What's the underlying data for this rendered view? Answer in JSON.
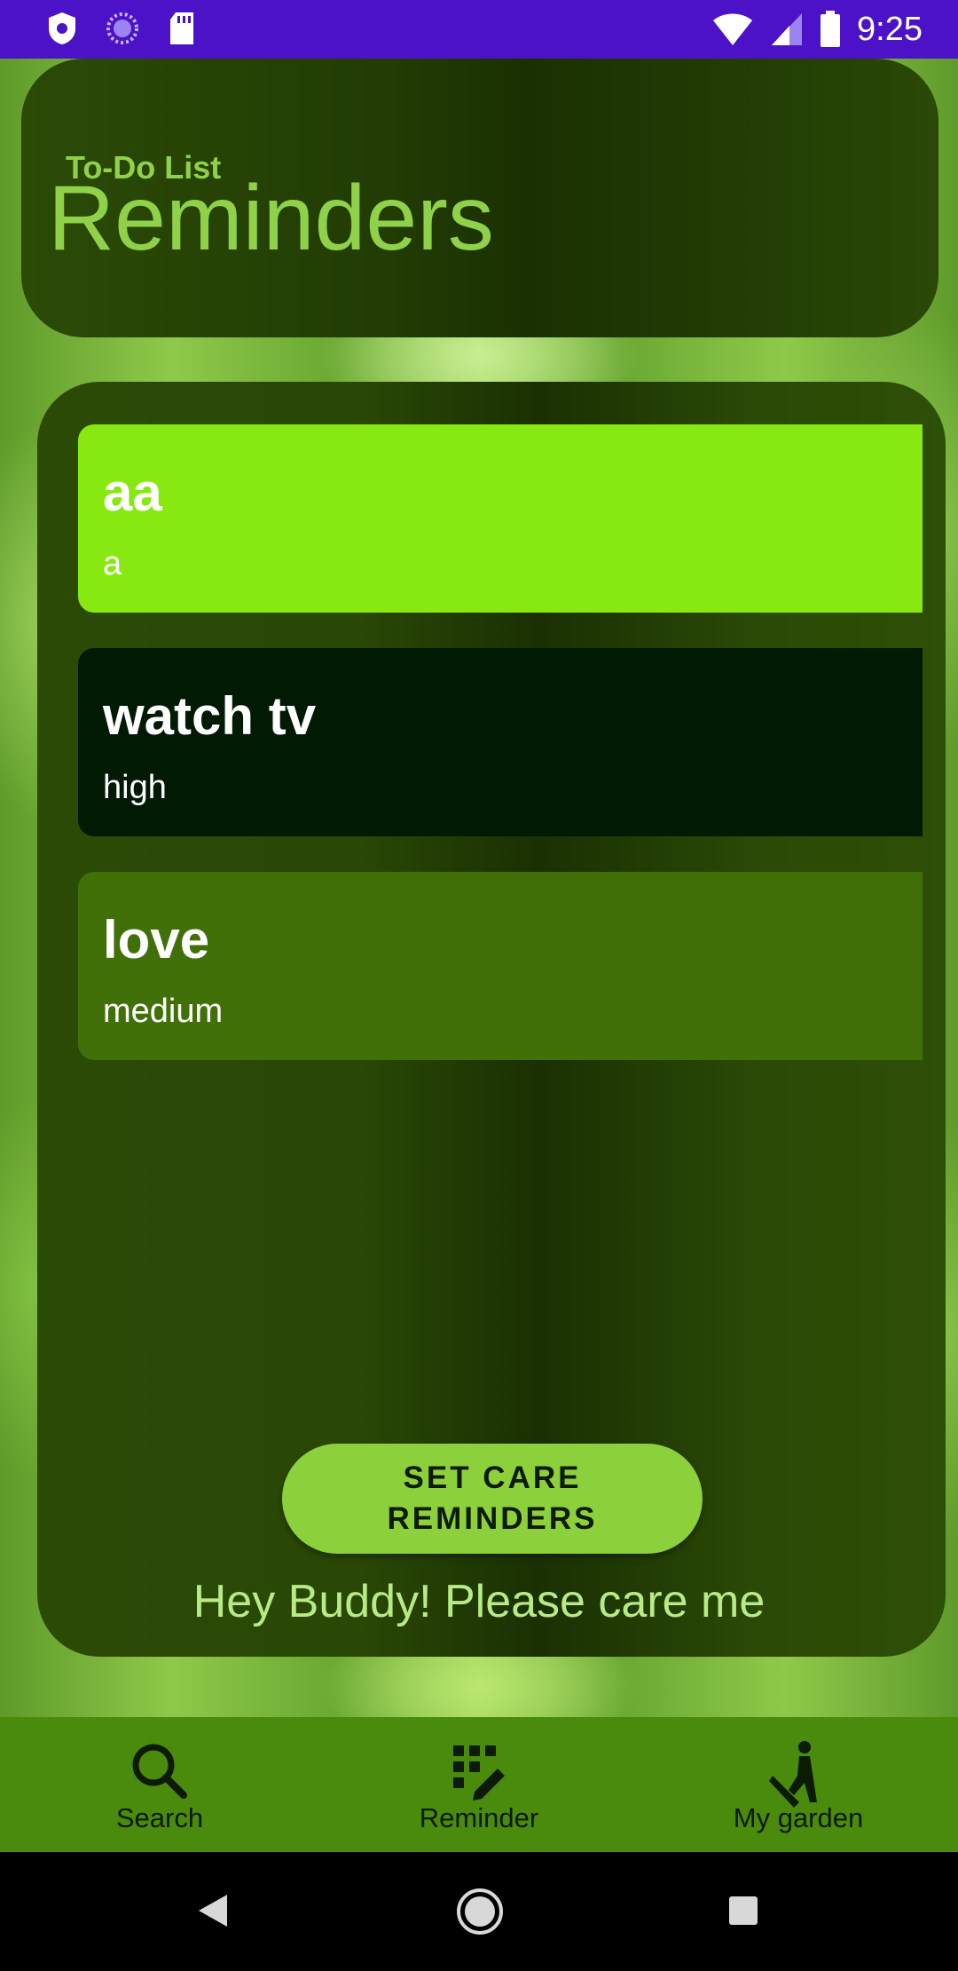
{
  "status_bar": {
    "time": "9:25",
    "icons": [
      "shield-icon",
      "sync-icon",
      "sd-card-icon",
      "wifi-icon",
      "signal-icon",
      "battery-icon"
    ]
  },
  "header": {
    "subtitle": "To-Do List",
    "title": "Reminders"
  },
  "reminders": [
    {
      "title": "aa",
      "priority": "a",
      "color": "#88e812"
    },
    {
      "title": "watch tv",
      "priority": "high",
      "color": "#011a04"
    },
    {
      "title": "love",
      "priority": "medium",
      "color": "#427008"
    }
  ],
  "care_button": {
    "label": "SET CARE REMINDERS"
  },
  "care_message": "Hey Buddy! Please care me",
  "bottom_nav": {
    "items": [
      {
        "label": "Search",
        "icon": "search-icon"
      },
      {
        "label": "Reminder",
        "icon": "reminder-icon"
      },
      {
        "label": "My garden",
        "icon": "gardening-icon"
      }
    ]
  },
  "system_nav": {
    "buttons": [
      "back-icon",
      "home-icon",
      "recents-icon"
    ]
  },
  "colors": {
    "status_bar": "#4b12c8",
    "accent_green": "#8fd24a",
    "button_green": "#8cd13c",
    "nav_green": "#4a8a0c"
  }
}
